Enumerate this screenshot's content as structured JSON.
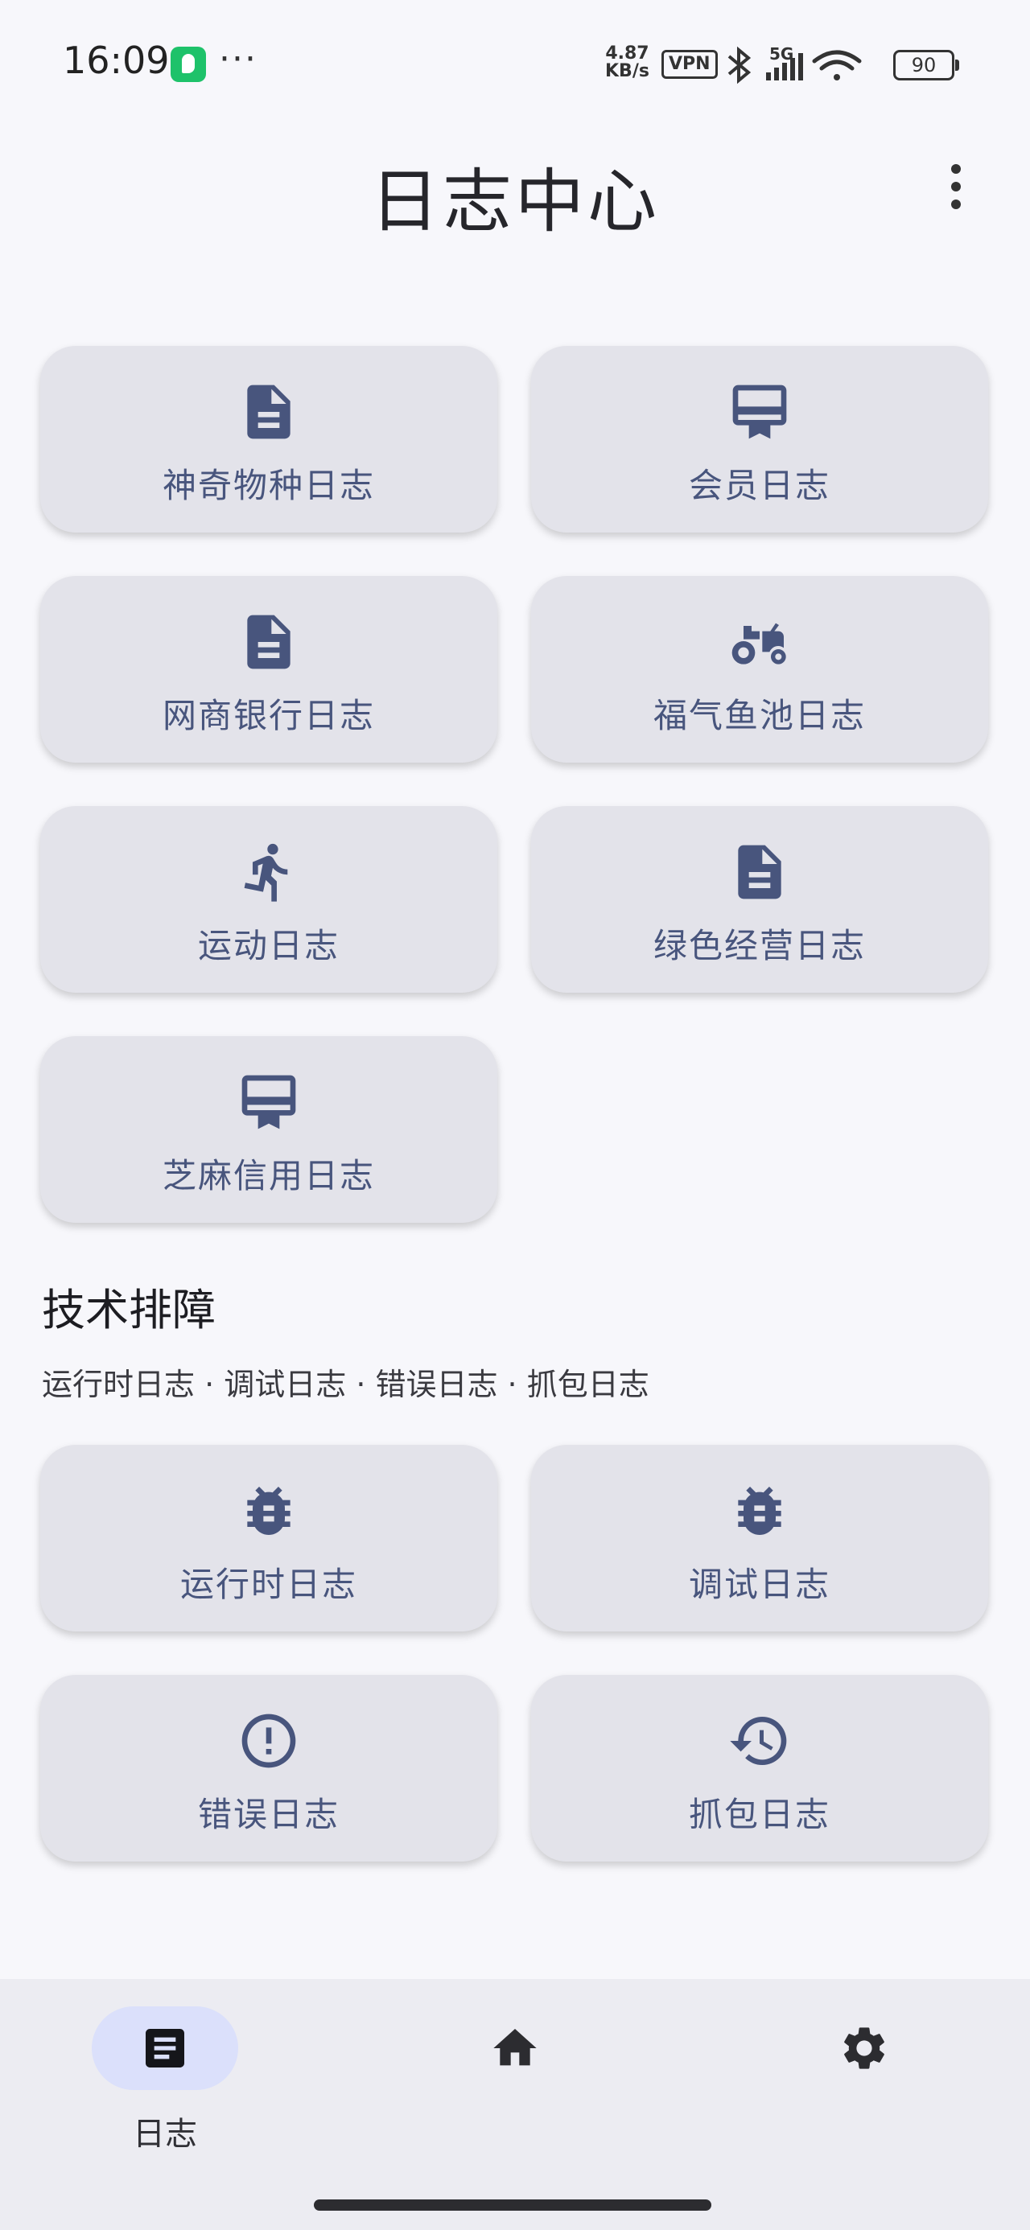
{
  "status_bar": {
    "time": "16:09",
    "more": "···",
    "net_speed_value": "4.87",
    "net_speed_unit": "KB/s",
    "vpn": "VPN",
    "signal": "5G",
    "battery": "90"
  },
  "header": {
    "title": "日志中心"
  },
  "log_cards": [
    {
      "label": "神奇物种日志",
      "icon": "document-icon"
    },
    {
      "label": "会员日志",
      "icon": "card-ribbon-icon"
    },
    {
      "label": "网商银行日志",
      "icon": "document-icon"
    },
    {
      "label": "福气鱼池日志",
      "icon": "tractor-icon"
    },
    {
      "label": "运动日志",
      "icon": "running-icon"
    },
    {
      "label": "绿色经营日志",
      "icon": "document-icon"
    },
    {
      "label": "芝麻信用日志",
      "icon": "card-ribbon-icon"
    }
  ],
  "tech_section": {
    "title": "技术排障",
    "subtitle": "运行时日志 · 调试日志 · 错误日志 · 抓包日志",
    "cards": [
      {
        "label": "运行时日志",
        "icon": "bug-icon"
      },
      {
        "label": "调试日志",
        "icon": "bug-icon"
      },
      {
        "label": "错误日志",
        "icon": "error-circle-icon"
      },
      {
        "label": "抓包日志",
        "icon": "history-icon"
      }
    ]
  },
  "bottom_nav": {
    "logs_label": "日志",
    "active_tab": "logs"
  },
  "colors": {
    "background": "#f7f7fb",
    "card": "#e3e3ea",
    "accent": "#48557d",
    "nav_pill": "#dbe0fb"
  }
}
